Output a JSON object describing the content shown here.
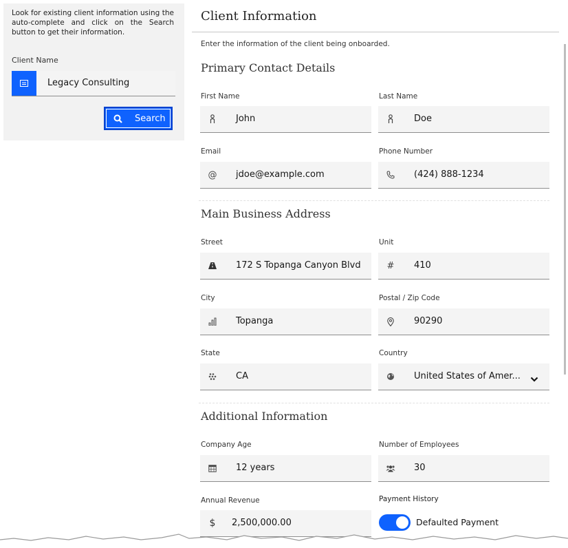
{
  "search_panel": {
    "hint": "Look for existing client information using the auto-complete and click on the Search button to get their information.",
    "client_name_label": "Client Name",
    "client_name_value": "Legacy Consulting",
    "search_button": "Search"
  },
  "form": {
    "title": "Client Information",
    "description": "Enter the information of the client being onboarded.",
    "sections": {
      "primary": "Primary Contact Details",
      "address": "Main Business Address",
      "additional": "Additional Information"
    },
    "fields": {
      "first_name": {
        "label": "First Name",
        "value": "John",
        "icon": "person-icon"
      },
      "last_name": {
        "label": "Last Name",
        "value": "Doe",
        "icon": "person-icon"
      },
      "email": {
        "label": "Email",
        "value": "jdoe@example.com",
        "icon": "at-icon"
      },
      "phone": {
        "label": "Phone Number",
        "value": "(424) 888-1234",
        "icon": "phone-icon"
      },
      "street": {
        "label": "Street",
        "value": "172 S Topanga Canyon Blvd",
        "icon": "road-icon"
      },
      "unit": {
        "label": "Unit",
        "value": "410",
        "icon": "hash-icon"
      },
      "city": {
        "label": "City",
        "value": "Topanga",
        "icon": "city-icon"
      },
      "postal": {
        "label": "Postal / Zip Code",
        "value": "90290",
        "icon": "location-pin-icon"
      },
      "state": {
        "label": "State",
        "value": "CA",
        "icon": "state-icon"
      },
      "country": {
        "label": "Country",
        "value": "United States of Amer...",
        "icon": "globe-icon"
      },
      "company_age": {
        "label": "Company Age",
        "value": "12 years",
        "icon": "calendar-icon"
      },
      "employees": {
        "label": "Number of Employees",
        "value": "30",
        "icon": "users-icon"
      },
      "revenue": {
        "label": "Annual Revenue",
        "value": "2,500,000.00",
        "icon_glyph": "$"
      }
    },
    "payment_history": {
      "label": "Payment History",
      "toggle_label": "Defaulted Payment",
      "on": true
    }
  },
  "colors": {
    "accent": "#0f62fe",
    "field_bg": "#f4f4f4",
    "panel_bg": "#f2f2f2"
  }
}
